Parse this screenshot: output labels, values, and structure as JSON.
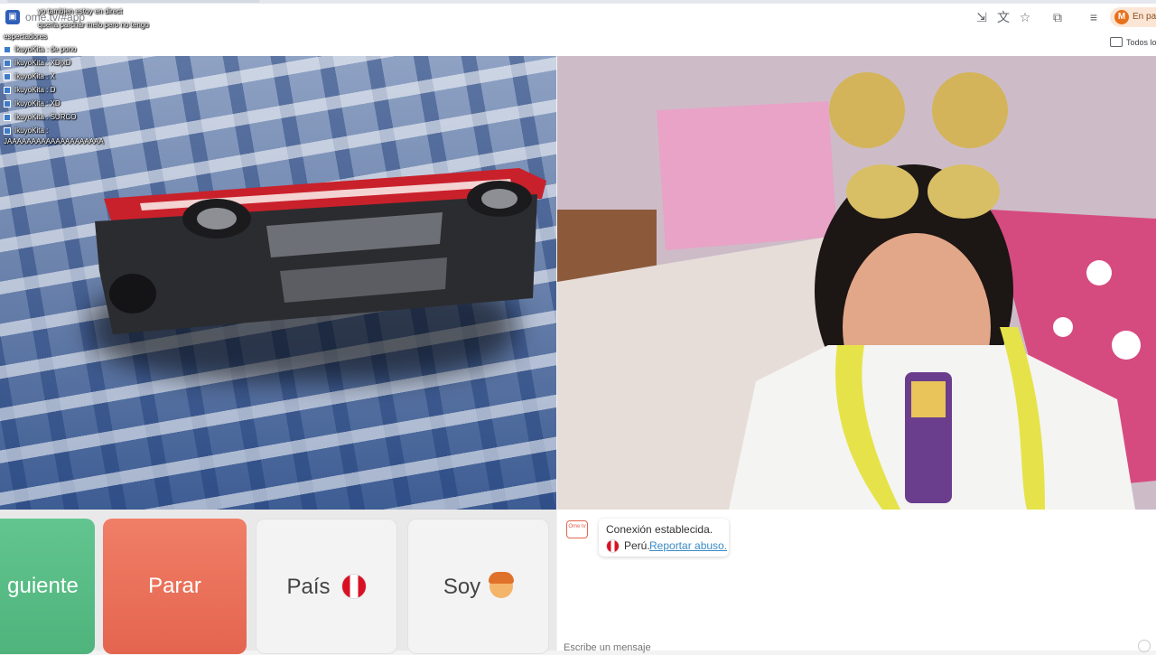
{
  "browser": {
    "url": "ome.tv/#app",
    "paused_label": "En pau",
    "paused_avatar": "M",
    "all_bookmarks": "Todos lo",
    "icons": [
      "install-app-icon",
      "translate-icon",
      "star-icon",
      "extensions-icon",
      "media-control-icon",
      "profile-icon"
    ]
  },
  "stream_chat": {
    "lines": [
      "yo tambien estoy en direct",
      "queria parchar melo pero no tengo",
      "espectadores",
      "IkuyoKita : de pono",
      "IkuyoKita : XD|xD",
      "IkuyoKita : X",
      "IkuyoKita : D",
      "IkuyoKita : XD",
      "IkuyoKita : SURCO",
      "IkuyoKita :",
      "JAAAAAAAAAAAAAAAAAAAA"
    ]
  },
  "controls": {
    "next_label": "guiente",
    "stop_label": "Parar",
    "country_label": "País",
    "gender_label": "Soy"
  },
  "chat": {
    "logo_text": "Ome tv",
    "connection_status": "Conexión establecida.",
    "peer_country": "Perú.",
    "report_link": "Reportar abuso.",
    "input_placeholder": "Escribe un mensaje"
  },
  "colors": {
    "next_button": "#4fb37c",
    "stop_button": "#e4654f",
    "neutral_button": "#f3f3f3",
    "link": "#3a8bc6"
  }
}
